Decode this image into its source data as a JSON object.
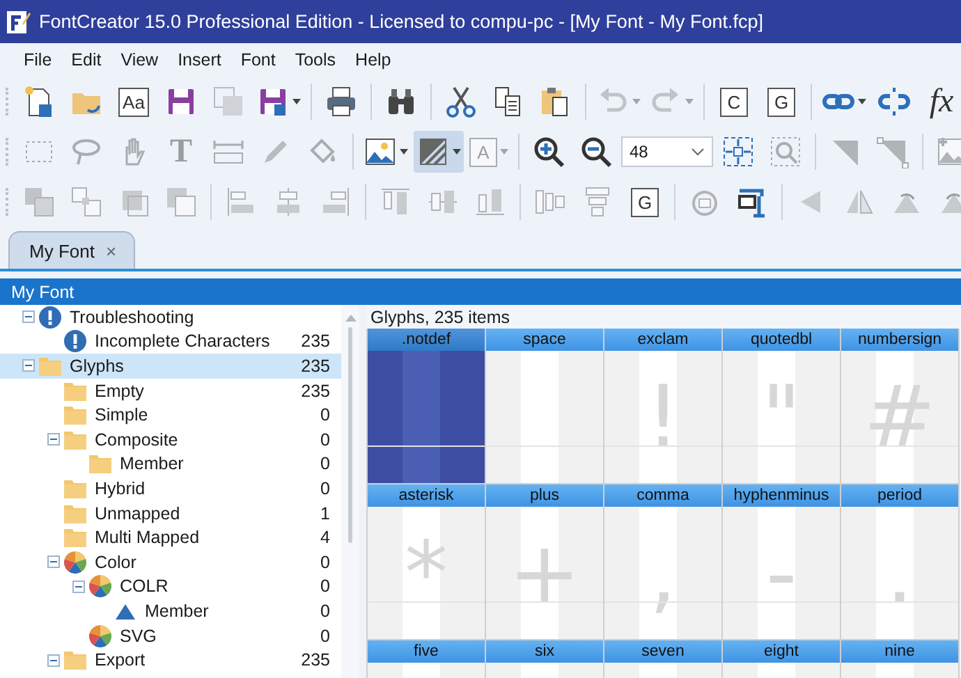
{
  "window": {
    "title": "FontCreator 15.0 Professional Edition - Licensed to compu-pc - [My Font - My Font.fcp]"
  },
  "menu": [
    "File",
    "Edit",
    "View",
    "Insert",
    "Font",
    "Tools",
    "Help"
  ],
  "toolbars": [
    {
      "items": [
        {
          "kind": "icon",
          "disabled": false,
          "pressed": false
        },
        {
          "kind": "icon",
          "disabled": false,
          "pressed": false
        },
        {
          "kind": "boxed-letter",
          "label": "Aa",
          "disabled": false,
          "pressed": false
        },
        {
          "kind": "icon",
          "disabled": false,
          "pressed": false
        },
        {
          "kind": "icon",
          "disabled": true,
          "pressed": false
        },
        {
          "kind": "icon",
          "disabled": false,
          "pressed": false,
          "dropdown": true
        },
        {
          "kind": "separator"
        },
        {
          "kind": "icon",
          "disabled": false,
          "pressed": false
        },
        {
          "kind": "separator"
        },
        {
          "kind": "icon",
          "disabled": false,
          "pressed": false
        },
        {
          "kind": "separator"
        },
        {
          "kind": "icon",
          "disabled": false,
          "pressed": false
        },
        {
          "kind": "icon",
          "disabled": false,
          "pressed": false
        },
        {
          "kind": "icon",
          "disabled": false,
          "pressed": false
        },
        {
          "kind": "separator"
        },
        {
          "kind": "icon",
          "disabled": true,
          "pressed": false,
          "dropdown": true
        },
        {
          "kind": "icon",
          "disabled": true,
          "pressed": false,
          "dropdown": true
        },
        {
          "kind": "separator"
        },
        {
          "kind": "boxed-letter",
          "label": "C",
          "disabled": false,
          "pressed": false
        },
        {
          "kind": "boxed-letter",
          "label": "G",
          "disabled": false,
          "pressed": false
        },
        {
          "kind": "separator"
        },
        {
          "kind": "icon",
          "disabled": false,
          "pressed": false,
          "dropdown": true
        },
        {
          "kind": "icon",
          "disabled": false,
          "pressed": false
        },
        {
          "kind": "letter",
          "label": "fx",
          "disabled": false,
          "pressed": false
        }
      ]
    },
    {
      "items": [
        {
          "kind": "icon",
          "disabled": true,
          "pressed": false
        },
        {
          "kind": "icon",
          "disabled": true,
          "pressed": false
        },
        {
          "kind": "icon",
          "disabled": true,
          "pressed": false
        },
        {
          "kind": "letter",
          "label": "T",
          "disabled": true,
          "pressed": false
        },
        {
          "kind": "icon",
          "disabled": true,
          "pressed": false
        },
        {
          "kind": "icon",
          "disabled": true,
          "pressed": false
        },
        {
          "kind": "icon",
          "disabled": true,
          "pressed": false
        },
        {
          "kind": "separator"
        },
        {
          "kind": "icon",
          "disabled": false,
          "pressed": false,
          "dropdown": true
        },
        {
          "kind": "icon",
          "disabled": false,
          "pressed": true,
          "dropdown": true
        },
        {
          "kind": "boxed-letter",
          "label": "A",
          "disabled": true,
          "pressed": false,
          "dropdown": true
        },
        {
          "kind": "separator"
        },
        {
          "kind": "icon",
          "disabled": false,
          "pressed": false
        },
        {
          "kind": "icon",
          "disabled": false,
          "pressed": false
        },
        {
          "kind": "combo",
          "value": "48"
        },
        {
          "kind": "icon",
          "disabled": false,
          "pressed": false
        },
        {
          "kind": "icon",
          "disabled": true,
          "pressed": false
        },
        {
          "kind": "separator"
        },
        {
          "kind": "icon",
          "disabled": true,
          "pressed": false
        },
        {
          "kind": "icon",
          "disabled": true,
          "pressed": false
        },
        {
          "kind": "separator"
        },
        {
          "kind": "icon",
          "disabled": true,
          "pressed": false
        }
      ]
    },
    {
      "items": [
        {
          "kind": "icon",
          "disabled": true,
          "pressed": false
        },
        {
          "kind": "icon",
          "disabled": true,
          "pressed": false
        },
        {
          "kind": "icon",
          "disabled": true,
          "pressed": false
        },
        {
          "kind": "icon",
          "disabled": true,
          "pressed": false
        },
        {
          "kind": "separator"
        },
        {
          "kind": "icon",
          "disabled": true,
          "pressed": false
        },
        {
          "kind": "icon",
          "disabled": true,
          "pressed": false
        },
        {
          "kind": "icon",
          "disabled": true,
          "pressed": false
        },
        {
          "kind": "separator"
        },
        {
          "kind": "icon",
          "disabled": true,
          "pressed": false
        },
        {
          "kind": "icon",
          "disabled": true,
          "pressed": false
        },
        {
          "kind": "icon",
          "disabled": true,
          "pressed": false
        },
        {
          "kind": "separator"
        },
        {
          "kind": "icon",
          "disabled": true,
          "pressed": false
        },
        {
          "kind": "icon",
          "disabled": true,
          "pressed": false
        },
        {
          "kind": "boxed-letter",
          "label": "G",
          "disabled": false,
          "pressed": false
        },
        {
          "kind": "separator"
        },
        {
          "kind": "icon",
          "disabled": true,
          "pressed": false
        },
        {
          "kind": "icon",
          "disabled": false,
          "pressed": false
        },
        {
          "kind": "separator"
        },
        {
          "kind": "icon",
          "disabled": true,
          "pressed": false
        },
        {
          "kind": "icon",
          "disabled": true,
          "pressed": false
        },
        {
          "kind": "icon",
          "disabled": true,
          "pressed": false
        },
        {
          "kind": "icon",
          "disabled": true,
          "pressed": false
        }
      ]
    }
  ],
  "tabs": [
    {
      "label": "My Font",
      "selected": true,
      "close": "×"
    }
  ],
  "panel": {
    "title": "My Font"
  },
  "tree": [
    {
      "label": "Troubleshooting",
      "kind": "warning",
      "expanded": true,
      "selected": false,
      "children": [
        {
          "label": "Incomplete Characters",
          "kind": "warning",
          "count": "235",
          "selected": false
        }
      ]
    },
    {
      "label": "Glyphs",
      "kind": "folder",
      "count": "235",
      "expanded": true,
      "selected": true,
      "children": [
        {
          "label": "Empty",
          "kind": "folder",
          "count": "235",
          "selected": false
        },
        {
          "label": "Simple",
          "kind": "folder",
          "count": "0",
          "selected": false
        },
        {
          "label": "Composite",
          "kind": "folder",
          "count": "0",
          "expanded": true,
          "selected": false,
          "children": [
            {
              "label": "Member",
              "kind": "folder",
              "count": "0",
              "selected": false
            }
          ]
        },
        {
          "label": "Hybrid",
          "kind": "folder",
          "count": "0",
          "selected": false
        },
        {
          "label": "Unmapped",
          "kind": "folder",
          "count": "1",
          "selected": false
        },
        {
          "label": "Multi Mapped",
          "kind": "folder",
          "count": "4",
          "selected": false
        },
        {
          "label": "Color",
          "kind": "palette",
          "count": "0",
          "expanded": true,
          "selected": false,
          "children": [
            {
              "label": "COLR",
              "kind": "palette",
              "count": "0",
              "expanded": true,
              "selected": false,
              "children": [
                {
                  "label": "Member",
                  "kind": "shape",
                  "count": "0",
                  "selected": false
                }
              ]
            },
            {
              "label": "SVG",
              "kind": "palette",
              "count": "0",
              "selected": false
            }
          ]
        },
        {
          "label": "Export",
          "kind": "folder",
          "count": "235",
          "expanded": true,
          "selected": false
        }
      ]
    }
  ],
  "glyphs": {
    "caption": "Glyphs, 235 items",
    "rows": [
      {
        "cells": [
          {
            "name": ".notdef",
            "selected": true
          },
          {
            "name": "space",
            "selected": false
          },
          {
            "name": "exclam",
            "preview": "!",
            "selected": false
          },
          {
            "name": "quotedbl",
            "preview": "\"",
            "selected": false
          },
          {
            "name": "numbersign",
            "preview": "#",
            "selected": false
          }
        ]
      },
      {
        "cells": [
          {
            "name": "asterisk",
            "preview": "*",
            "selected": false
          },
          {
            "name": "plus",
            "preview": "+",
            "selected": false
          },
          {
            "name": "comma",
            "preview": ",",
            "selected": false
          },
          {
            "name": "hyphenminus",
            "preview": "-",
            "selected": false
          },
          {
            "name": "period",
            "preview": ".",
            "selected": false
          }
        ]
      },
      {
        "cells": [
          {
            "name": "five",
            "selected": false
          },
          {
            "name": "six",
            "selected": false
          },
          {
            "name": "seven",
            "selected": false
          },
          {
            "name": "eight",
            "selected": false
          },
          {
            "name": "nine",
            "selected": false
          }
        ]
      }
    ]
  }
}
